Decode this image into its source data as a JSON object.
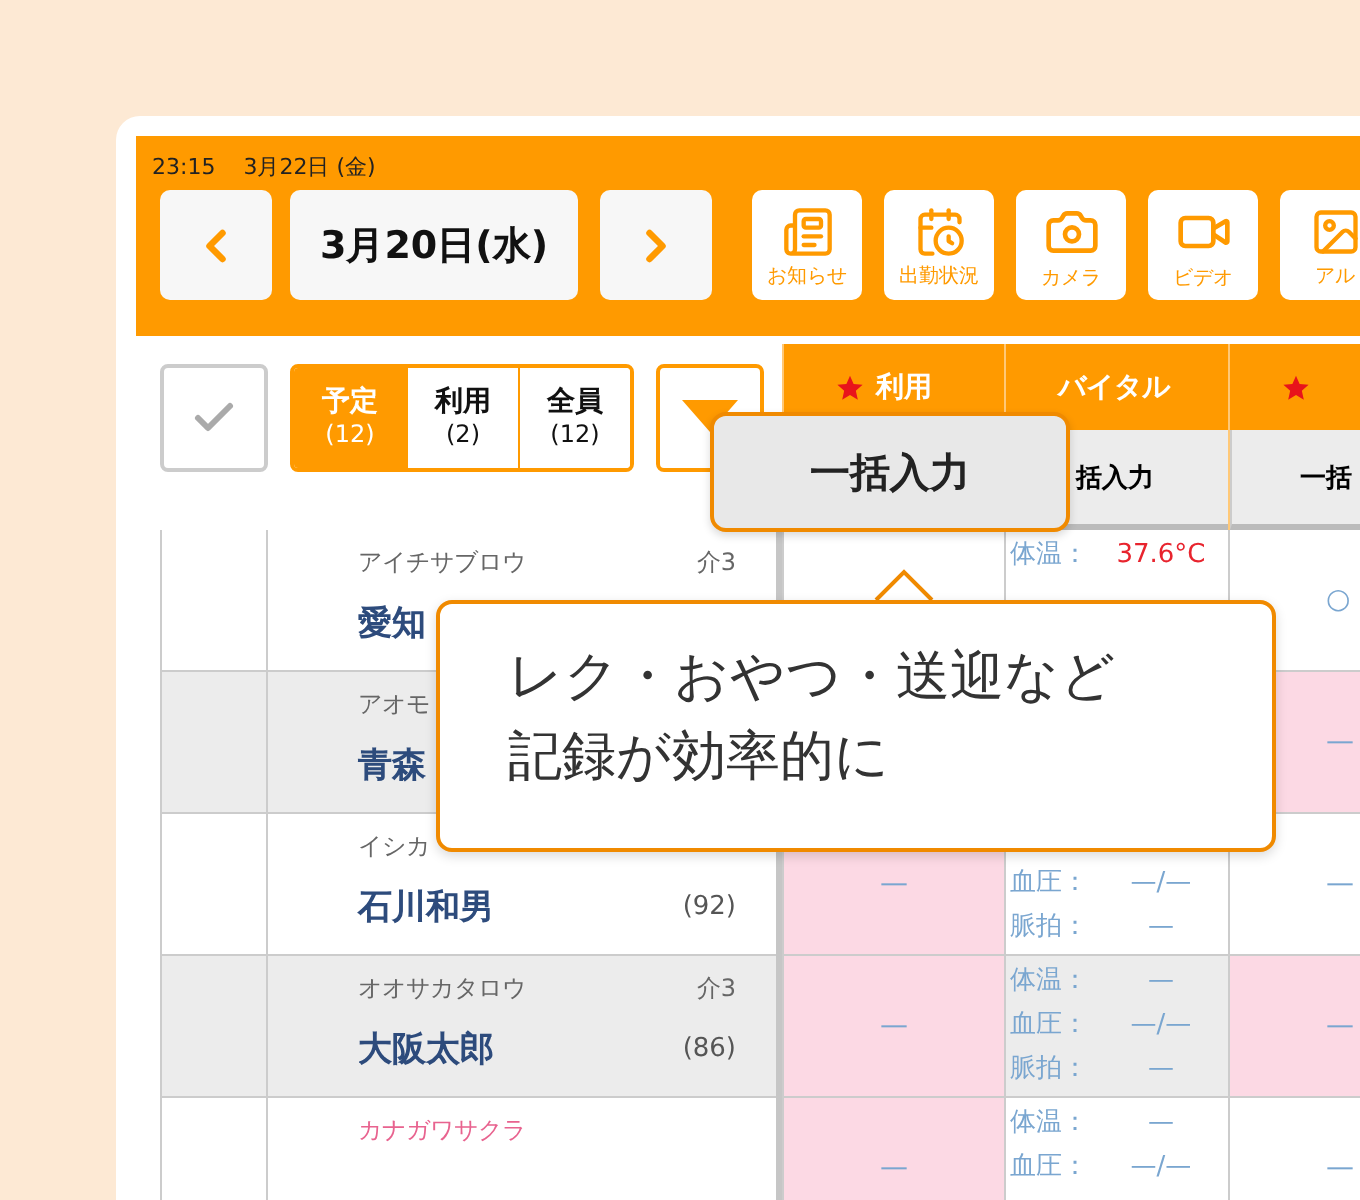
{
  "status_bar": {
    "time": "23:15",
    "date": "3月22日 (金)"
  },
  "date_nav": {
    "date": "3月20日(水)"
  },
  "toolbar_icons": [
    {
      "kind": "notice",
      "label": "お知らせ"
    },
    {
      "kind": "attendance",
      "label": "出勤状況"
    },
    {
      "kind": "camera",
      "label": "カメラ"
    },
    {
      "kind": "video",
      "label": "ビデオ"
    },
    {
      "kind": "album",
      "label": "アル"
    }
  ],
  "filter_tabs": [
    {
      "label": "予定",
      "count": "(12)",
      "selected": true
    },
    {
      "label": "利用",
      "count": "(2)",
      "selected": false
    },
    {
      "label": "全員",
      "count": "(12)",
      "selected": false
    }
  ],
  "columns": [
    {
      "title": "利用",
      "starred": true
    },
    {
      "title": "バイタル",
      "starred": false,
      "bulk": "括入力"
    },
    {
      "starred": true,
      "bulk": "一括"
    }
  ],
  "rows": [
    {
      "kana": "アイチサブロウ",
      "care": "介3",
      "name": "愛知",
      "color": "#2d4b7c",
      "shaded": false,
      "cells": [
        {
          "kind": "covered"
        },
        {
          "kind": "vitals",
          "flagged": false,
          "lines": [
            {
              "kind": "temperature",
              "label": "体温：",
              "value": "37.6°C",
              "alert": true
            }
          ]
        },
        {
          "kind": "text",
          "text": "○",
          "flagged": false
        }
      ]
    },
    {
      "kana": "アオモ",
      "name": "青森",
      "color": "#2d4b7c",
      "shaded": true,
      "cells": [
        {
          "kind": "covered"
        },
        {
          "kind": "covered"
        },
        {
          "kind": "text",
          "text": "—",
          "flagged": true
        }
      ]
    },
    {
      "kana": "イシカ",
      "name": "石川和男",
      "age": "(92)",
      "color": "#2d4b7c",
      "shaded": false,
      "cells": [
        {
          "kind": "text",
          "text": "—",
          "flagged": true
        },
        {
          "kind": "vitals",
          "flagged": false,
          "lines": [
            {
              "kind": "pressure",
              "label": "血圧：",
              "value": "—/—",
              "alert": false
            },
            {
              "kind": "pulse",
              "label": "脈拍：",
              "value": "—",
              "alert": false
            }
          ]
        },
        {
          "kind": "text",
          "text": "—",
          "flagged": false
        }
      ]
    },
    {
      "kana": "オオサカタロウ",
      "care": "介3",
      "name": "大阪太郎",
      "age": "(86)",
      "color": "#2d4b7c",
      "shaded": true,
      "cells": [
        {
          "kind": "text",
          "text": "—",
          "flagged": true
        },
        {
          "kind": "vitals",
          "flagged": false,
          "lines": [
            {
              "kind": "temperature",
              "label": "体温：",
              "value": "—",
              "alert": false
            },
            {
              "kind": "pressure",
              "label": "血圧：",
              "value": "—/—",
              "alert": false
            },
            {
              "kind": "pulse",
              "label": "脈拍：",
              "value": "—",
              "alert": false
            }
          ]
        },
        {
          "kind": "text",
          "text": "—",
          "flagged": true
        }
      ]
    },
    {
      "kana": "カナガワサクラ",
      "color": "#e8638f",
      "shaded": false,
      "cells": [
        {
          "kind": "text",
          "text": "—",
          "flagged": true
        },
        {
          "kind": "vitals",
          "flagged": false,
          "lines": [
            {
              "kind": "temperature",
              "label": "体温：",
              "value": "—",
              "alert": false
            },
            {
              "kind": "pressure",
              "label": "血圧：",
              "value": "—/—",
              "alert": false
            }
          ]
        },
        {
          "kind": "text",
          "text": "—",
          "flagged": false
        }
      ]
    }
  ],
  "callouts": [
    {
      "text": "一括入力"
    },
    {
      "lines": [
        "レク・おやつ・送迎など",
        "記録が効率的に"
      ]
    }
  ]
}
